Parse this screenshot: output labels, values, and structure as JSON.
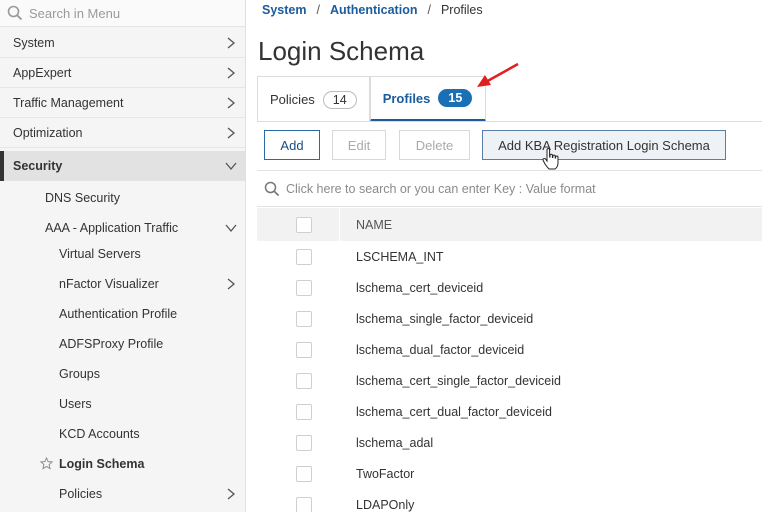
{
  "sidebar": {
    "search_placeholder": "Search in Menu",
    "items": [
      {
        "label": "System"
      },
      {
        "label": "AppExpert"
      },
      {
        "label": "Traffic Management"
      },
      {
        "label": "Optimization"
      },
      {
        "label": "Security"
      },
      {
        "label": "DNS Security"
      },
      {
        "label": "AAA - Application Traffic"
      },
      {
        "label": "Virtual Servers"
      },
      {
        "label": "nFactor Visualizer"
      },
      {
        "label": "Authentication Profile"
      },
      {
        "label": "ADFSProxy Profile"
      },
      {
        "label": "Groups"
      },
      {
        "label": "Users"
      },
      {
        "label": "KCD Accounts"
      },
      {
        "label": "Login Schema"
      },
      {
        "label": "Policies"
      }
    ]
  },
  "breadcrumb": {
    "items": [
      "System",
      "Authentication",
      "Profiles"
    ],
    "separator": "/"
  },
  "page_title": "Login Schema",
  "tabs": [
    {
      "label": "Policies",
      "count": "14"
    },
    {
      "label": "Profiles",
      "count": "15"
    }
  ],
  "toolbar": {
    "add": "Add",
    "edit": "Edit",
    "delete": "Delete",
    "kba": "Add KBA Registration Login Schema"
  },
  "search": {
    "placeholder": "Click here to search or you can enter Key : Value format"
  },
  "table": {
    "header": "NAME",
    "rows": [
      "LSCHEMA_INT",
      "lschema_cert_deviceid",
      "lschema_single_factor_deviceid",
      "lschema_dual_factor_deviceid",
      "lschema_cert_single_factor_deviceid",
      "lschema_cert_dual_factor_deviceid",
      "lschema_adal",
      "TwoFactor",
      "LDAPOnly"
    ]
  },
  "colors": {
    "accent": "#1a5c9e",
    "badge": "#1a6fb5",
    "annotation_arrow": "#e02020"
  }
}
